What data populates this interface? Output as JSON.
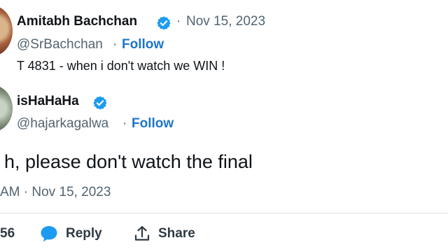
{
  "quoted_tweet": {
    "author_name": "Amitabh Bachchan",
    "separator": "·",
    "date": "Nov 15, 2023",
    "handle": "@SrBachchan",
    "follow_label": "Follow",
    "text": "T 4831 - when i don't watch we WIN  !"
  },
  "main_tweet": {
    "author_name": "isHaHaHa",
    "handle": "@hajarkagalwa",
    "separator": "·",
    "follow_label": "Follow",
    "text": "h, please don't watch the final",
    "timestamp": "AM · Nov 15, 2023"
  },
  "actions": {
    "count_partial": "56",
    "reply_label": "Reply",
    "share_label": "Share"
  },
  "colors": {
    "link": "#1d75c9",
    "verified": "#1d9bf0",
    "muted": "#536471"
  },
  "icons": [
    "verified-badge-icon",
    "reply-bubble-icon",
    "share-upload-icon"
  ]
}
